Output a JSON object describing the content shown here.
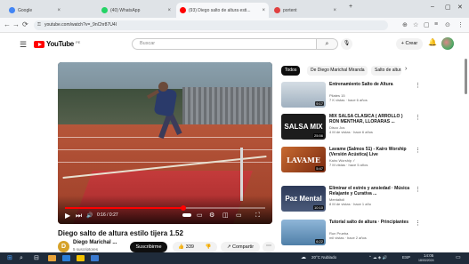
{
  "browser": {
    "tabs": [
      {
        "label": "Google",
        "favicon_color": "#4285f4",
        "active": false
      },
      {
        "label": "(40) WhatsApp",
        "favicon_color": "#25d366",
        "active": false
      },
      {
        "label": "(93) Diego salto de altura esti...",
        "favicon_color": "#ff0000",
        "active": true
      },
      {
        "label": "portent",
        "favicon_color": "#e04040",
        "active": false
      }
    ],
    "new_tab": "+",
    "window_controls": {
      "minimize": "–",
      "maximize": "▢",
      "close": "✕"
    },
    "nav": {
      "back": "←",
      "forward": "→",
      "reload": "⟳",
      "home": "⌂"
    },
    "url": "youtube.com/watch?v=_9nChr87U4I",
    "ext_icons": [
      "⊕",
      "☆",
      "▢",
      "≡",
      "⊙",
      "⋮"
    ]
  },
  "youtube": {
    "logo_text": "YouTube",
    "logo_country": "PE",
    "search_placeholder": "Buscar",
    "search_button": "⌕",
    "mic": "🎙",
    "create_label": "+ Crear",
    "bell": "🔔"
  },
  "player": {
    "time": "0:16 / 0:27",
    "progress": 0.59,
    "controls": {
      "play": "▶",
      "next": "⏭",
      "volume": "🔊",
      "cc": "▭",
      "settings": "⚙",
      "miniplayer": "◫",
      "theater": "▭",
      "fullscreen": "⛶"
    }
  },
  "video": {
    "title": "Diego salto de altura estilo tijera 1.52",
    "channel": "Diego Marichal ...",
    "channel_initial": "D",
    "subscribers": "5 suscriptores",
    "subscribe_label": "Suscribirme",
    "likes": "339",
    "like_icon": "👍",
    "dislike_icon": "👎",
    "share_label": "↗ Compartir",
    "more": "⋯"
  },
  "chips": [
    "Todos",
    "De Diego Marichal Miranda",
    "Salto de altura"
  ],
  "chip_next": "›",
  "recommendations": [
    {
      "title": "Entrenamiento Salto de Altura",
      "channel": "Pilates 15",
      "meta": "7 K vistas · hace 6 años",
      "duration": "9:17",
      "thumb_bg": "#c8d4de",
      "overlay": ""
    },
    {
      "title": "MIX SALSA CLASICA ( ARROLLO ) RON MENTHAR, LLORARAS ...",
      "channel": "Disco Jus",
      "meta": "4 M de vistas · hace 6 años",
      "duration": "25:56",
      "thumb_bg": "#1c1c1c",
      "overlay": "SALSA MIX"
    },
    {
      "title": "Lavame (Salmos 51) - Kairo Worship (Versión Acústica) Live",
      "channel": "Kairo Worship ✓",
      "meta": "7 M vistas · hace 5 años",
      "duration": "5:47",
      "thumb_bg": "#b04a20",
      "overlay": "LAVAME"
    },
    {
      "title": "Eliminar el estrés y ansiedad · Música Relajante y Curativa ...",
      "channel": "Mentaltoli",
      "meta": "8 M de vistas · hace 1 año",
      "duration": "10:10",
      "thumb_bg": "#3a4a6a",
      "overlay": "Paz Mental"
    },
    {
      "title": "Tutorial salto de altura · Principiantes",
      "channel": "Run Prueba",
      "meta": "mil vistas · hace 2 años",
      "duration": "6:22",
      "thumb_bg": "#5f8fb8",
      "overlay": ""
    }
  ],
  "taskbar": {
    "start": "⊞",
    "search": "⌕",
    "apps": [
      "⊟",
      "◐",
      "▤",
      "◆",
      "◉"
    ],
    "weather": "20°C Nublado",
    "tray_icons": "⌃ ☁ ◈ 🔊",
    "lang": "ESP",
    "time": "14:05",
    "date": "18/03/2024"
  }
}
